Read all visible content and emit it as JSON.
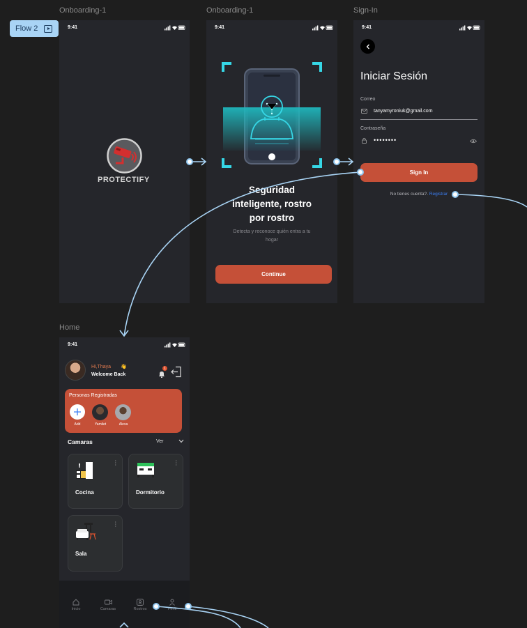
{
  "flow_tag": {
    "label": "Flow 2"
  },
  "frames": {
    "onboarding1": {
      "label": "Onboarding-1",
      "time": "9:41",
      "logo_text": "PROTECTIFY"
    },
    "onboarding2": {
      "label": "Onboarding-1",
      "time": "9:41",
      "headline_1": "Seguridad",
      "headline_2": "inteligente, rostro",
      "headline_3": "por rostro",
      "subtext_1": "Detecta y reconoce quién entra a tu",
      "subtext_2": "hogar",
      "continue_label": "Continue"
    },
    "signin": {
      "label": "Sign-In",
      "time": "9:41",
      "title": "Iniciar Sesión",
      "email_label": "Correo",
      "email_value": "tanyamyroniuk@gmail.com",
      "password_label": "Contraseña",
      "password_value": "••••••••",
      "signin_label": "Sign In",
      "no_account": "No tienes cuenta?.",
      "register": "Registrar"
    },
    "home": {
      "label": "Home",
      "time": "9:41",
      "greeting": "Hi,Thaya",
      "welcome": "Welcome Back",
      "notification_count": "1",
      "registered_title": "Personas Registradas",
      "people": [
        {
          "name": "Add"
        },
        {
          "name": "Yamilet"
        },
        {
          "name": "Alexa"
        }
      ],
      "cameras_title": "Camaras",
      "see_all": "Ver",
      "rooms": [
        {
          "label": "Cocina"
        },
        {
          "label": "Dormitorio"
        },
        {
          "label": "Sala"
        }
      ],
      "nav": [
        {
          "label": "Inicio"
        },
        {
          "label": "Camaras"
        },
        {
          "label": "Rostros"
        },
        {
          "label": "Perfil"
        }
      ]
    }
  },
  "colors": {
    "background": "#1e1e1e",
    "phone": "#25262b",
    "accent": "#c55038",
    "connector": "#a9d4f5",
    "link": "#3b7ff5",
    "face_scan": "#36d7e6"
  }
}
